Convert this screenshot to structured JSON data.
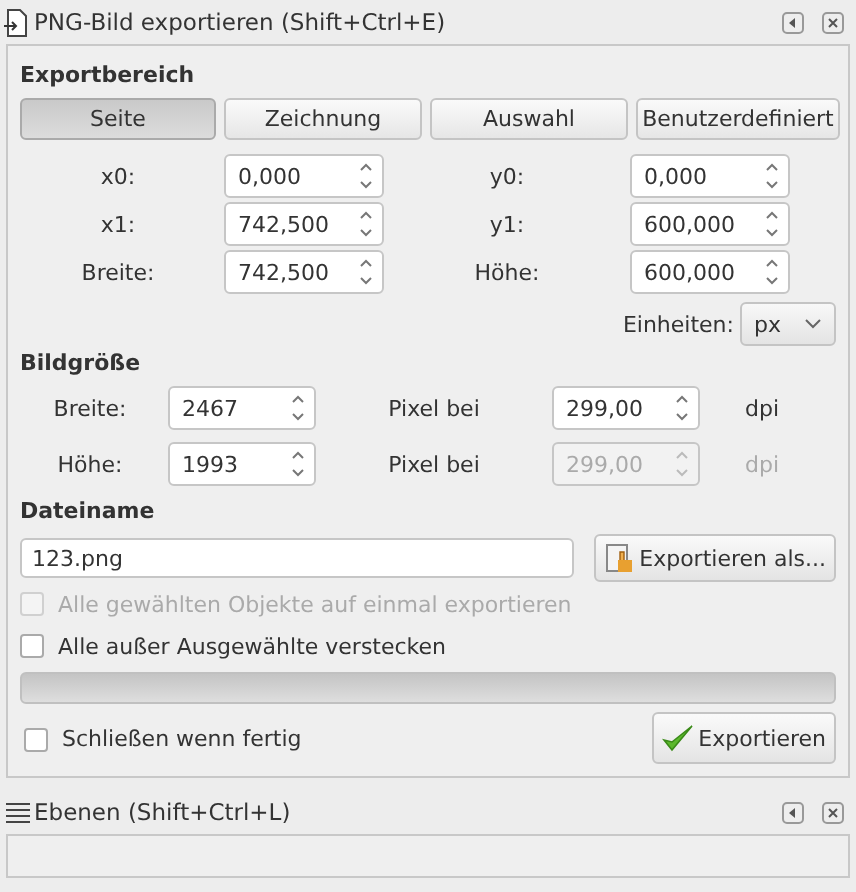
{
  "dialog": {
    "title": "PNG-Bild exportieren (Shift+Ctrl+E)"
  },
  "export_area": {
    "heading": "Exportbereich",
    "tabs": [
      {
        "label": "Seite",
        "selected": true
      },
      {
        "label": "Zeichnung",
        "selected": false
      },
      {
        "label": "Auswahl",
        "selected": false
      },
      {
        "label": "Benutzerdefiniert",
        "selected": false
      }
    ],
    "fields": [
      {
        "label": "x0:",
        "value": "0,000"
      },
      {
        "label": "y0:",
        "value": "0,000"
      },
      {
        "label": "x1:",
        "value": "742,500"
      },
      {
        "label": "y1:",
        "value": "600,000"
      },
      {
        "label": "Breite:",
        "value": "742,500"
      },
      {
        "label": "Höhe:",
        "value": "600,000"
      }
    ],
    "units": {
      "label": "Einheiten:",
      "value": "px"
    }
  },
  "image_size": {
    "heading": "Bildgröße",
    "rows": [
      {
        "label": "Breite:",
        "value": "2467",
        "dpi_label": "Pixel bei",
        "dpi": "299,00",
        "unit": "dpi",
        "disabled": false
      },
      {
        "label": "Höhe:",
        "value": "1993",
        "dpi_label": "Pixel bei",
        "dpi": "299,00",
        "unit": "dpi",
        "disabled": true
      }
    ]
  },
  "filename": {
    "heading": "Dateiname",
    "value": "123.png",
    "button": "Exportieren als..."
  },
  "options": [
    {
      "label": "Alle gewählten Objekte auf einmal exportieren",
      "checked": false,
      "disabled": true
    },
    {
      "label": "Alle außer Ausgewählte verstecken",
      "checked": false,
      "disabled": false
    }
  ],
  "progress": {
    "level": 0
  },
  "close_when_done": {
    "label": "Schließen wenn fertig",
    "checked": false
  },
  "export_button": "Exportieren",
  "next_dialog": {
    "title": "Ebenen (Shift+Ctrl+L)"
  }
}
